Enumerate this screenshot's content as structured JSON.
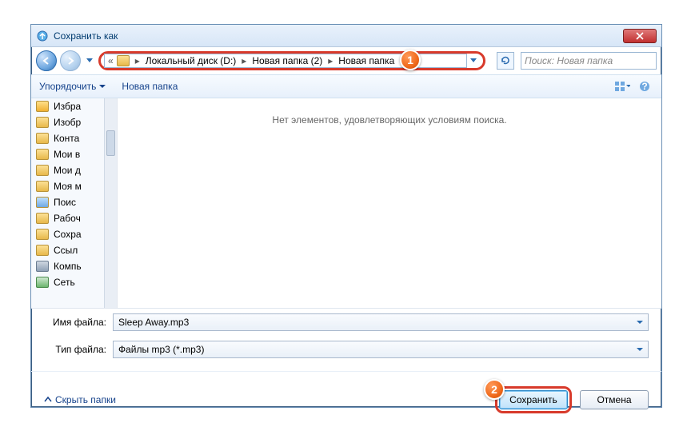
{
  "title": "Сохранить как",
  "breadcrumb": [
    "Локальный диск (D:)",
    "Новая папка (2)",
    "Новая папка"
  ],
  "search_placeholder": "Поиск: Новая папка",
  "toolbar": {
    "organize": "Упорядочить",
    "newfolder": "Новая папка"
  },
  "empty_message": "Нет элементов, удовлетворяющих условиям поиска.",
  "sidebar": [
    "Избра",
    "Изобр",
    "Конта",
    "Мои в",
    "Мои д",
    "Моя м",
    "Поис",
    "Рабоч",
    "Сохра",
    "Ссыл"
  ],
  "sidebar_comp": "Компь",
  "sidebar_net": "Сеть",
  "filename_label": "Имя файла:",
  "filename_value": "Sleep Away.mp3",
  "filetype_label": "Тип файла:",
  "filetype_value": "Файлы mp3 (*.mp3)",
  "hide_folders": "Скрыть папки",
  "save_btn": "Сохранить",
  "cancel_btn": "Отмена",
  "badge1": "1",
  "badge2": "2"
}
